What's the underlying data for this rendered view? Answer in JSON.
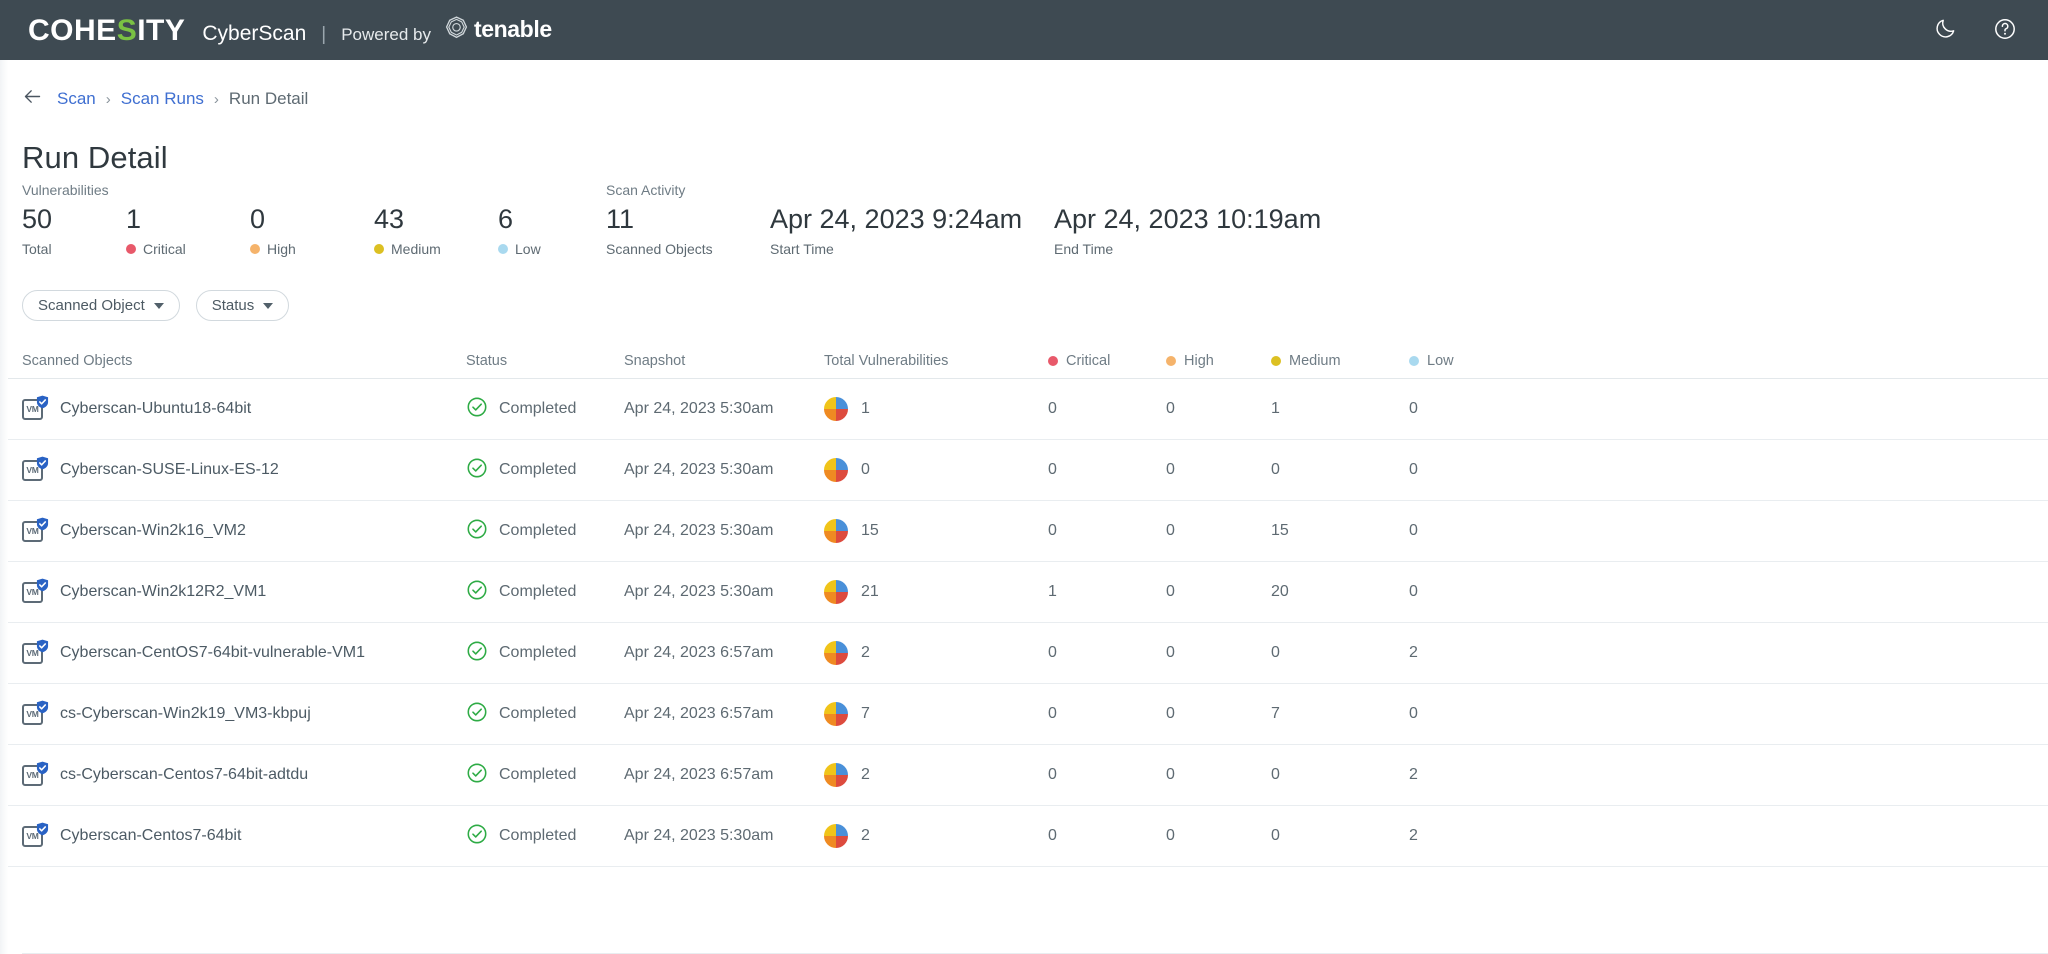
{
  "topbar": {
    "logo_cohe": "COHE",
    "logo_s": "S",
    "logo_ity": "ITY",
    "product": "CyberScan",
    "separator": "|",
    "powered_by": "Powered by",
    "partner": "tenable",
    "dark_mode_icon": "moon-icon",
    "help_icon": "help-circle-icon",
    "bar_color": "#3e4a52",
    "accent_color": "#7ac143"
  },
  "breadcrumb": {
    "back_icon": "arrow-left-icon",
    "items": [
      {
        "label": "Scan",
        "link": true
      },
      {
        "label": "Scan Runs",
        "link": true
      },
      {
        "label": "Run Detail",
        "link": false
      }
    ],
    "caret": "›",
    "link_color": "#3f6fd1"
  },
  "page_title": "Run Detail",
  "summary": {
    "vulnerabilities_label": "Vulnerabilities",
    "scan_activity_label": "Scan Activity",
    "stats": [
      {
        "value": "50",
        "label": "Total",
        "dot": null,
        "dot_color": null
      },
      {
        "value": "1",
        "label": "Critical",
        "dot": "critical",
        "dot_color": "#e8596a"
      },
      {
        "value": "0",
        "label": "High",
        "dot": "high",
        "dot_color": "#f5b36b"
      },
      {
        "value": "43",
        "label": "Medium",
        "dot": "medium",
        "dot_color": "#dcc022"
      },
      {
        "value": "6",
        "label": "Low",
        "dot": "low",
        "dot_color": "#a9d9ef"
      }
    ],
    "activity": [
      {
        "value": "11",
        "label": "Scanned Objects"
      },
      {
        "value": "Apr 24, 2023 9:24am",
        "label": "Start Time"
      },
      {
        "value": "Apr 24, 2023 10:19am",
        "label": "End Time"
      }
    ]
  },
  "filters": [
    {
      "label": "Scanned Object",
      "icon": "chevron-down-icon"
    },
    {
      "label": "Status",
      "icon": "chevron-down-icon"
    }
  ],
  "table": {
    "columns": [
      {
        "label": "Scanned Objects",
        "dot_color": null
      },
      {
        "label": "Status",
        "dot_color": null
      },
      {
        "label": "Snapshot",
        "dot_color": null
      },
      {
        "label": "Total Vulnerabilities",
        "dot_color": null
      },
      {
        "label": "Critical",
        "dot_color": "#e8596a"
      },
      {
        "label": "High",
        "dot_color": "#f5b36b"
      },
      {
        "label": "Medium",
        "dot_color": "#dcc022"
      },
      {
        "label": "Low",
        "dot_color": "#a9d9ef"
      }
    ],
    "rows": [
      {
        "name": "Cyberscan-Ubuntu18-64bit",
        "icon": "vm-protected-icon",
        "status": "Completed",
        "status_icon": "check-circle-icon",
        "snapshot": "Apr 24, 2023 5:30am",
        "total": "1",
        "critical": "0",
        "high": "0",
        "medium": "1",
        "low": "0"
      },
      {
        "name": "Cyberscan-SUSE-Linux-ES-12",
        "icon": "vm-protected-icon",
        "status": "Completed",
        "status_icon": "check-circle-icon",
        "snapshot": "Apr 24, 2023 5:30am",
        "total": "0",
        "critical": "0",
        "high": "0",
        "medium": "0",
        "low": "0"
      },
      {
        "name": "Cyberscan-Win2k16_VM2",
        "icon": "vm-protected-icon",
        "status": "Completed",
        "status_icon": "check-circle-icon",
        "snapshot": "Apr 24, 2023 5:30am",
        "total": "15",
        "critical": "0",
        "high": "0",
        "medium": "15",
        "low": "0"
      },
      {
        "name": "Cyberscan-Win2k12R2_VM1",
        "icon": "vm-protected-icon",
        "status": "Completed",
        "status_icon": "check-circle-icon",
        "snapshot": "Apr 24, 2023 5:30am",
        "total": "21",
        "critical": "1",
        "high": "0",
        "medium": "20",
        "low": "0"
      },
      {
        "name": "Cyberscan-CentOS7-64bit-vulnerable-VM1",
        "icon": "vm-protected-icon",
        "status": "Completed",
        "status_icon": "check-circle-icon",
        "snapshot": "Apr 24, 2023 6:57am",
        "total": "2",
        "critical": "0",
        "high": "0",
        "medium": "0",
        "low": "2"
      },
      {
        "name": "cs-Cyberscan-Win2k19_VM3-kbpuj",
        "icon": "vm-protected-icon",
        "status": "Completed",
        "status_icon": "check-circle-icon",
        "snapshot": "Apr 24, 2023 6:57am",
        "total": "7",
        "critical": "0",
        "high": "0",
        "medium": "7",
        "low": "0"
      },
      {
        "name": "cs-Cyberscan-Centos7-64bit-adtdu",
        "icon": "vm-protected-icon",
        "status": "Completed",
        "status_icon": "check-circle-icon",
        "snapshot": "Apr 24, 2023 6:57am",
        "total": "2",
        "critical": "0",
        "high": "0",
        "medium": "0",
        "low": "2"
      },
      {
        "name": "Cyberscan-Centos7-64bit",
        "icon": "vm-protected-icon",
        "status": "Completed",
        "status_icon": "check-circle-icon",
        "snapshot": "Apr 24, 2023 5:30am",
        "total": "2",
        "critical": "0",
        "high": "0",
        "medium": "0",
        "low": "2"
      }
    ]
  }
}
